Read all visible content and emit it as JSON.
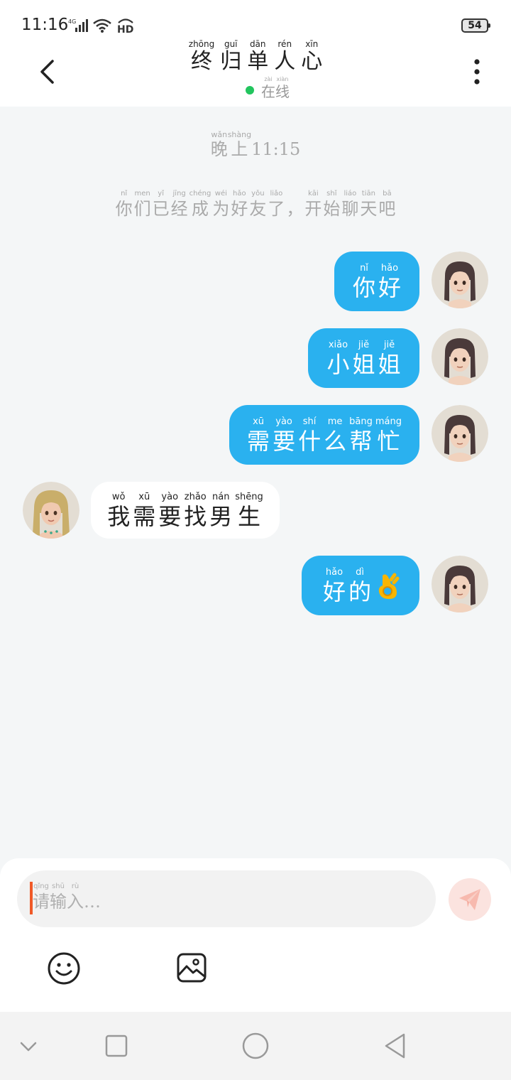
{
  "status_bar": {
    "time": "11:16",
    "network": "4G",
    "hd": "HD",
    "battery": "54"
  },
  "header": {
    "title": [
      {
        "py": "zhōng",
        "hz": "终"
      },
      {
        "py": "guī",
        "hz": "归"
      },
      {
        "py": "dān",
        "hz": "单"
      },
      {
        "py": "rén",
        "hz": "人"
      },
      {
        "py": "xīn",
        "hz": "心"
      }
    ],
    "status": [
      {
        "py": "zài",
        "hz": "在"
      },
      {
        "py": "xiàn",
        "hz": "线"
      }
    ],
    "status_color": "#22c55e"
  },
  "chat": {
    "time_label": {
      "chars": [
        {
          "py": "wǎn",
          "hz": "晚"
        },
        {
          "py": "shàng",
          "hz": "上"
        }
      ],
      "time": "11:15"
    },
    "system_notice": [
      {
        "py": "nǐ",
        "hz": "你"
      },
      {
        "py": "men",
        "hz": "们"
      },
      {
        "py": "yǐ",
        "hz": "已"
      },
      {
        "py": "jīng",
        "hz": "经"
      },
      {
        "py": "chéng",
        "hz": "成"
      },
      {
        "py": "wéi",
        "hz": "为"
      },
      {
        "py": "hǎo",
        "hz": "好"
      },
      {
        "py": "yǒu",
        "hz": "友"
      },
      {
        "py": "liǎo",
        "hz": "了"
      },
      {
        "py": "",
        "hz": "，"
      },
      {
        "py": "kāi",
        "hz": "开"
      },
      {
        "py": "shǐ",
        "hz": "始"
      },
      {
        "py": "liáo",
        "hz": "聊"
      },
      {
        "py": "tiān",
        "hz": "天"
      },
      {
        "py": "bā",
        "hz": "吧"
      }
    ],
    "messages": [
      {
        "side": "out",
        "chars": [
          {
            "py": "nǐ",
            "hz": "你"
          },
          {
            "py": "hǎo",
            "hz": "好"
          }
        ]
      },
      {
        "side": "out",
        "chars": [
          {
            "py": "xiǎo",
            "hz": "小"
          },
          {
            "py": "jiě",
            "hz": "姐"
          },
          {
            "py": "jiě",
            "hz": "姐"
          }
        ]
      },
      {
        "side": "out",
        "chars": [
          {
            "py": "xū",
            "hz": "需"
          },
          {
            "py": "yào",
            "hz": "要"
          },
          {
            "py": "shí",
            "hz": "什"
          },
          {
            "py": "me",
            "hz": "么"
          },
          {
            "py": "bāng",
            "hz": "帮"
          },
          {
            "py": "máng",
            "hz": "忙"
          }
        ]
      },
      {
        "side": "in",
        "chars": [
          {
            "py": "wǒ",
            "hz": "我"
          },
          {
            "py": "xū",
            "hz": "需"
          },
          {
            "py": "yào",
            "hz": "要"
          },
          {
            "py": "zhǎo",
            "hz": "找"
          },
          {
            "py": "nán",
            "hz": "男"
          },
          {
            "py": "shēng",
            "hz": "生"
          }
        ]
      },
      {
        "side": "out",
        "chars": [
          {
            "py": "hǎo",
            "hz": "好"
          },
          {
            "py": "dì",
            "hz": "的"
          }
        ],
        "emoji": "ok-hand"
      }
    ],
    "outgoing_bubble_color": "#2ab1ef",
    "incoming_bubble_color": "#ffffff"
  },
  "input": {
    "placeholder": [
      {
        "py": "qǐng",
        "hz": "请"
      },
      {
        "py": "shū",
        "hz": "输"
      },
      {
        "py": "rù",
        "hz": "入"
      }
    ],
    "ellipsis": "…",
    "send_icon": "paper-plane-icon",
    "emoji_icon": "smiley-icon",
    "image_icon": "image-icon"
  },
  "nav_bar": {
    "icons": [
      "chevron-down-icon",
      "square-icon",
      "circle-icon",
      "triangle-back-icon"
    ]
  }
}
